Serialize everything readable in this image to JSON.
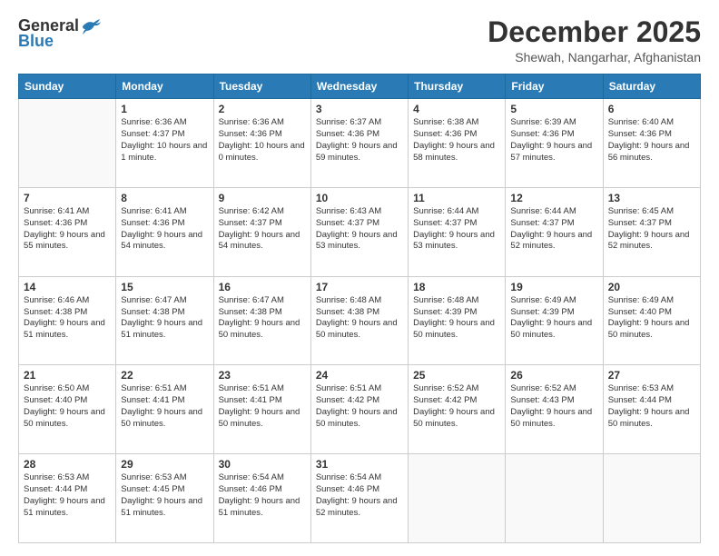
{
  "header": {
    "logo_line1": "General",
    "logo_line2": "Blue",
    "main_title": "December 2025",
    "sub_title": "Shewah, Nangarhar, Afghanistan"
  },
  "days_of_week": [
    "Sunday",
    "Monday",
    "Tuesday",
    "Wednesday",
    "Thursday",
    "Friday",
    "Saturday"
  ],
  "weeks": [
    [
      {
        "day": "",
        "sunrise": "",
        "sunset": "",
        "daylight": ""
      },
      {
        "day": "1",
        "sunrise": "Sunrise: 6:36 AM",
        "sunset": "Sunset: 4:37 PM",
        "daylight": "Daylight: 10 hours and 1 minute."
      },
      {
        "day": "2",
        "sunrise": "Sunrise: 6:36 AM",
        "sunset": "Sunset: 4:36 PM",
        "daylight": "Daylight: 10 hours and 0 minutes."
      },
      {
        "day": "3",
        "sunrise": "Sunrise: 6:37 AM",
        "sunset": "Sunset: 4:36 PM",
        "daylight": "Daylight: 9 hours and 59 minutes."
      },
      {
        "day": "4",
        "sunrise": "Sunrise: 6:38 AM",
        "sunset": "Sunset: 4:36 PM",
        "daylight": "Daylight: 9 hours and 58 minutes."
      },
      {
        "day": "5",
        "sunrise": "Sunrise: 6:39 AM",
        "sunset": "Sunset: 4:36 PM",
        "daylight": "Daylight: 9 hours and 57 minutes."
      },
      {
        "day": "6",
        "sunrise": "Sunrise: 6:40 AM",
        "sunset": "Sunset: 4:36 PM",
        "daylight": "Daylight: 9 hours and 56 minutes."
      }
    ],
    [
      {
        "day": "7",
        "sunrise": "Sunrise: 6:41 AM",
        "sunset": "Sunset: 4:36 PM",
        "daylight": "Daylight: 9 hours and 55 minutes."
      },
      {
        "day": "8",
        "sunrise": "Sunrise: 6:41 AM",
        "sunset": "Sunset: 4:36 PM",
        "daylight": "Daylight: 9 hours and 54 minutes."
      },
      {
        "day": "9",
        "sunrise": "Sunrise: 6:42 AM",
        "sunset": "Sunset: 4:37 PM",
        "daylight": "Daylight: 9 hours and 54 minutes."
      },
      {
        "day": "10",
        "sunrise": "Sunrise: 6:43 AM",
        "sunset": "Sunset: 4:37 PM",
        "daylight": "Daylight: 9 hours and 53 minutes."
      },
      {
        "day": "11",
        "sunrise": "Sunrise: 6:44 AM",
        "sunset": "Sunset: 4:37 PM",
        "daylight": "Daylight: 9 hours and 53 minutes."
      },
      {
        "day": "12",
        "sunrise": "Sunrise: 6:44 AM",
        "sunset": "Sunset: 4:37 PM",
        "daylight": "Daylight: 9 hours and 52 minutes."
      },
      {
        "day": "13",
        "sunrise": "Sunrise: 6:45 AM",
        "sunset": "Sunset: 4:37 PM",
        "daylight": "Daylight: 9 hours and 52 minutes."
      }
    ],
    [
      {
        "day": "14",
        "sunrise": "Sunrise: 6:46 AM",
        "sunset": "Sunset: 4:38 PM",
        "daylight": "Daylight: 9 hours and 51 minutes."
      },
      {
        "day": "15",
        "sunrise": "Sunrise: 6:47 AM",
        "sunset": "Sunset: 4:38 PM",
        "daylight": "Daylight: 9 hours and 51 minutes."
      },
      {
        "day": "16",
        "sunrise": "Sunrise: 6:47 AM",
        "sunset": "Sunset: 4:38 PM",
        "daylight": "Daylight: 9 hours and 50 minutes."
      },
      {
        "day": "17",
        "sunrise": "Sunrise: 6:48 AM",
        "sunset": "Sunset: 4:38 PM",
        "daylight": "Daylight: 9 hours and 50 minutes."
      },
      {
        "day": "18",
        "sunrise": "Sunrise: 6:48 AM",
        "sunset": "Sunset: 4:39 PM",
        "daylight": "Daylight: 9 hours and 50 minutes."
      },
      {
        "day": "19",
        "sunrise": "Sunrise: 6:49 AM",
        "sunset": "Sunset: 4:39 PM",
        "daylight": "Daylight: 9 hours and 50 minutes."
      },
      {
        "day": "20",
        "sunrise": "Sunrise: 6:49 AM",
        "sunset": "Sunset: 4:40 PM",
        "daylight": "Daylight: 9 hours and 50 minutes."
      }
    ],
    [
      {
        "day": "21",
        "sunrise": "Sunrise: 6:50 AM",
        "sunset": "Sunset: 4:40 PM",
        "daylight": "Daylight: 9 hours and 50 minutes."
      },
      {
        "day": "22",
        "sunrise": "Sunrise: 6:51 AM",
        "sunset": "Sunset: 4:41 PM",
        "daylight": "Daylight: 9 hours and 50 minutes."
      },
      {
        "day": "23",
        "sunrise": "Sunrise: 6:51 AM",
        "sunset": "Sunset: 4:41 PM",
        "daylight": "Daylight: 9 hours and 50 minutes."
      },
      {
        "day": "24",
        "sunrise": "Sunrise: 6:51 AM",
        "sunset": "Sunset: 4:42 PM",
        "daylight": "Daylight: 9 hours and 50 minutes."
      },
      {
        "day": "25",
        "sunrise": "Sunrise: 6:52 AM",
        "sunset": "Sunset: 4:42 PM",
        "daylight": "Daylight: 9 hours and 50 minutes."
      },
      {
        "day": "26",
        "sunrise": "Sunrise: 6:52 AM",
        "sunset": "Sunset: 4:43 PM",
        "daylight": "Daylight: 9 hours and 50 minutes."
      },
      {
        "day": "27",
        "sunrise": "Sunrise: 6:53 AM",
        "sunset": "Sunset: 4:44 PM",
        "daylight": "Daylight: 9 hours and 50 minutes."
      }
    ],
    [
      {
        "day": "28",
        "sunrise": "Sunrise: 6:53 AM",
        "sunset": "Sunset: 4:44 PM",
        "daylight": "Daylight: 9 hours and 51 minutes."
      },
      {
        "day": "29",
        "sunrise": "Sunrise: 6:53 AM",
        "sunset": "Sunset: 4:45 PM",
        "daylight": "Daylight: 9 hours and 51 minutes."
      },
      {
        "day": "30",
        "sunrise": "Sunrise: 6:54 AM",
        "sunset": "Sunset: 4:46 PM",
        "daylight": "Daylight: 9 hours and 51 minutes."
      },
      {
        "day": "31",
        "sunrise": "Sunrise: 6:54 AM",
        "sunset": "Sunset: 4:46 PM",
        "daylight": "Daylight: 9 hours and 52 minutes."
      },
      {
        "day": "",
        "sunrise": "",
        "sunset": "",
        "daylight": ""
      },
      {
        "day": "",
        "sunrise": "",
        "sunset": "",
        "daylight": ""
      },
      {
        "day": "",
        "sunrise": "",
        "sunset": "",
        "daylight": ""
      }
    ]
  ]
}
